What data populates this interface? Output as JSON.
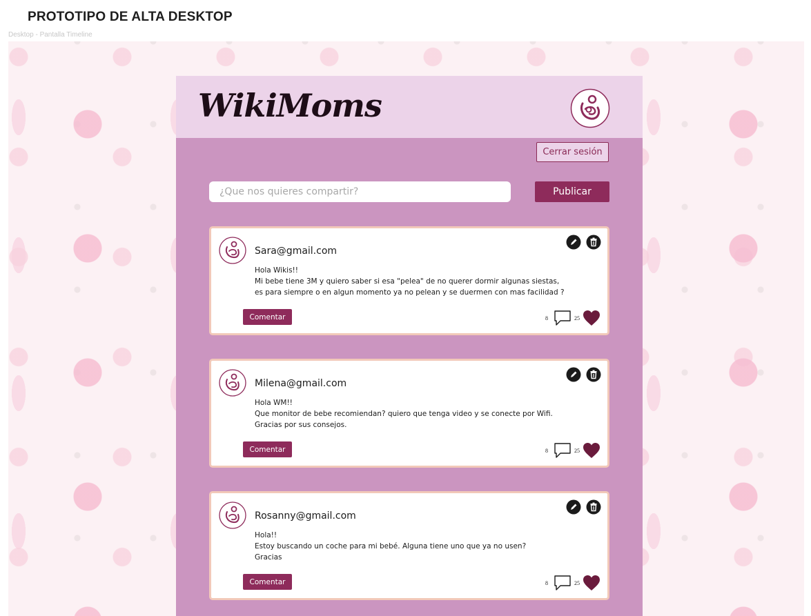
{
  "page": {
    "heading": "PROTOTIPO DE ALTA DESKTOP",
    "frame_label": "Desktop - Pantalla Timeline"
  },
  "header": {
    "logo_text": "WikiMoms",
    "logout_label": "Cerrar sesión"
  },
  "composer": {
    "placeholder": "¿Que nos quieres compartir?",
    "publish_label": "Publicar"
  },
  "colors": {
    "app_bg": "#cb95c0",
    "header_bg": "#ecd3e9",
    "accent": "#8e2b5b",
    "card_border": "#f2c9b9",
    "heart": "#6a1b3c"
  },
  "posts": [
    {
      "author": "Sara@gmail.com",
      "lines": [
        "Hola Wikis!!",
        "Mi bebe tiene 3M y quiero saber si esa \"pelea\" de no querer dormir algunas siestas,",
        "es para siempre o en algun momento ya no pelean y se duermen con mas facilidad ?"
      ],
      "comment_label": "Comentar",
      "comments_count": "8",
      "likes_count": "25"
    },
    {
      "author": "Milena@gmail.com",
      "lines": [
        "Hola WM!!",
        "Que monitor de bebe recomiendan? quiero que tenga video y se conecte por Wifi.",
        "Gracias por sus consejos."
      ],
      "comment_label": "Comentar",
      "comments_count": "8",
      "likes_count": "25"
    },
    {
      "author": "Rosanny@gmail.com",
      "lines": [
        "Hola!!",
        "Estoy buscando un coche para mi bebé. Alguna tiene uno que ya no usen?",
        "Gracias"
      ],
      "comment_label": "Comentar",
      "comments_count": "8",
      "likes_count": "25"
    }
  ]
}
